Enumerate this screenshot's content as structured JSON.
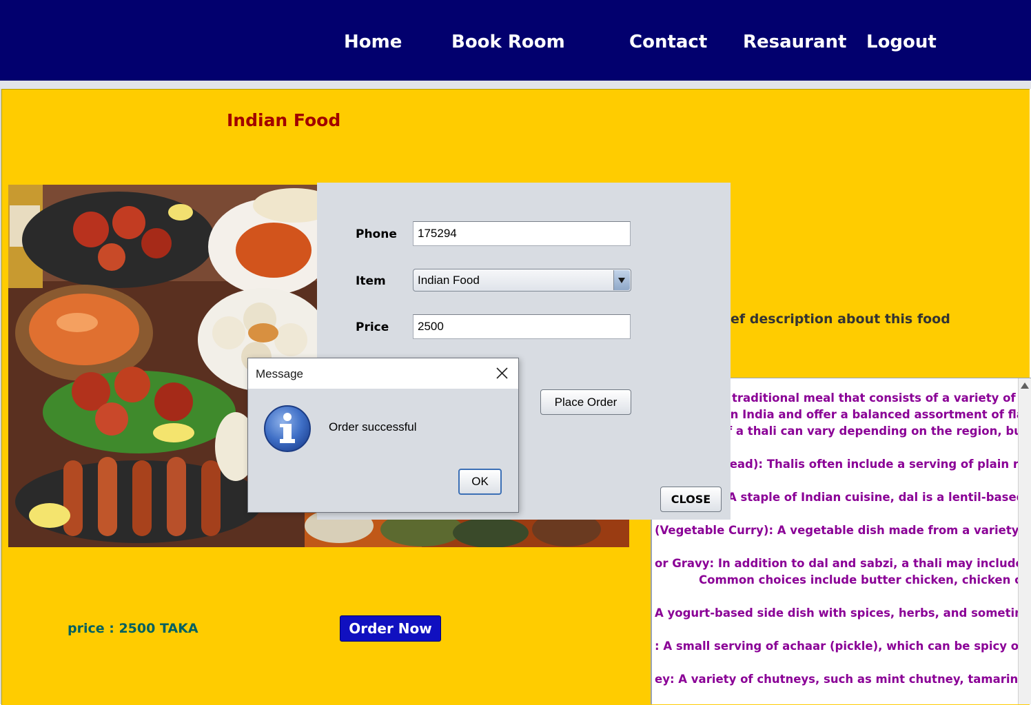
{
  "nav": {
    "home": "Home",
    "book_room": "Book Room",
    "contact": "Contact",
    "restaurant": "Resaurant",
    "logout": "Logout"
  },
  "page": {
    "title": "Indian Food",
    "price_text": "price : 2500 TAKA",
    "order_now": "Order Now",
    "description_heading": "ef description about this food"
  },
  "description_lines": [
    " traditional meal that consists of a variety of dish",
    "in India and offer a balanced assortment of flavor",
    "f a thali can vary depending on the region, but it",
    "",
    " Bread): Thalis often include a serving of plain ric",
    "",
    "A staple of Indian cuisine, dal is a lentil-based cur",
    "",
    "(Vegetable Curry): A vegetable dish made from a variety of se",
    "",
    "or Gravy: In addition to dal and sabzi, a thali may include a cu",
    "Common choices include butter chicken, chicken curry",
    "",
    " A yogurt-based side dish with spices, herbs, and sometimes gr",
    "",
    ": A small serving of achaar (pickle), which can be spicy or swee",
    "",
    "ey: A variety of chutneys, such as mint chutney, tamarind chu"
  ],
  "order_form": {
    "phone_label": "Phone",
    "phone_value": "175294",
    "item_label": "Item",
    "item_value": "Indian Food",
    "price_label": "Price",
    "price_value": "2500",
    "place_order": "Place Order",
    "close": "CLOSE"
  },
  "dialog": {
    "title": "Message",
    "message": "Order successful",
    "ok": "OK",
    "icon": "info-icon"
  },
  "colors": {
    "nav_background": "#02006e",
    "page_background": "#ffcc00",
    "title_color": "#a00000",
    "description_color": "#8a0096",
    "price_color": "#006060",
    "order_button": "#1010c0"
  }
}
